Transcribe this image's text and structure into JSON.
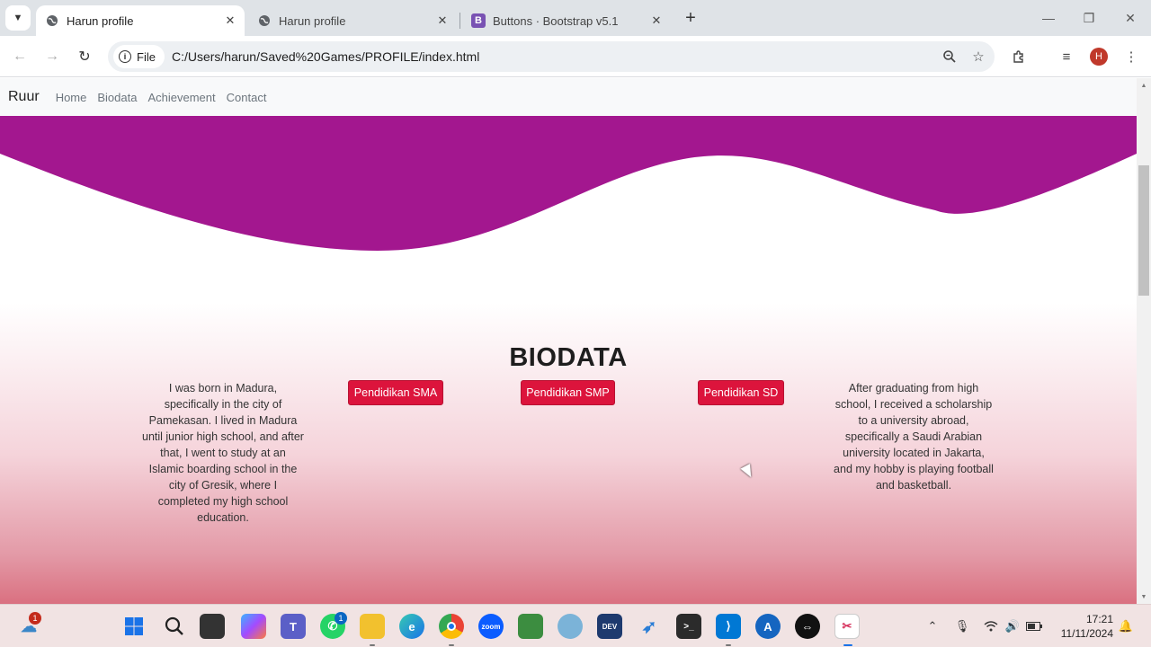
{
  "tabs": [
    {
      "title": "Harun profile",
      "active": true,
      "icon": "globe-icon"
    },
    {
      "title": "Harun profile",
      "active": false,
      "icon": "globe-icon"
    },
    {
      "title": "Buttons · Bootstrap v5.1",
      "active": false,
      "icon": "bootstrap-icon",
      "icon_letter": "B"
    }
  ],
  "toolbar": {
    "chip_label": "File",
    "url": "C:/Users/harun/Saved%20Games/PROFILE/index.html",
    "profile_initial": "H"
  },
  "page": {
    "brand": "Ruur",
    "nav": [
      "Home",
      "Biodata",
      "Achievement",
      "Contact"
    ],
    "section_title": "BIODATA",
    "left_text": "I was born in Madura, specifically in the city of Pamekasan. I lived in Madura until junior high school, and after that, I went to study at an Islamic boarding school in the city of Gresik, where I completed my high school education.",
    "right_text": "After graduating from high school, I received a scholarship to a university abroad, specifically a Saudi Arabian university located in Jakarta, and my hobby is playing football and basketball.",
    "buttons": [
      "Pendidikan SMA",
      "Pendidikan SMP",
      "Pendidikan SD"
    ],
    "colors": {
      "wave": "#a3178f",
      "button": "#dc143c"
    }
  },
  "taskbar": {
    "weather_badge": "1",
    "whatsapp_badge": "1",
    "time": "17:21",
    "date": "11/11/2024"
  }
}
